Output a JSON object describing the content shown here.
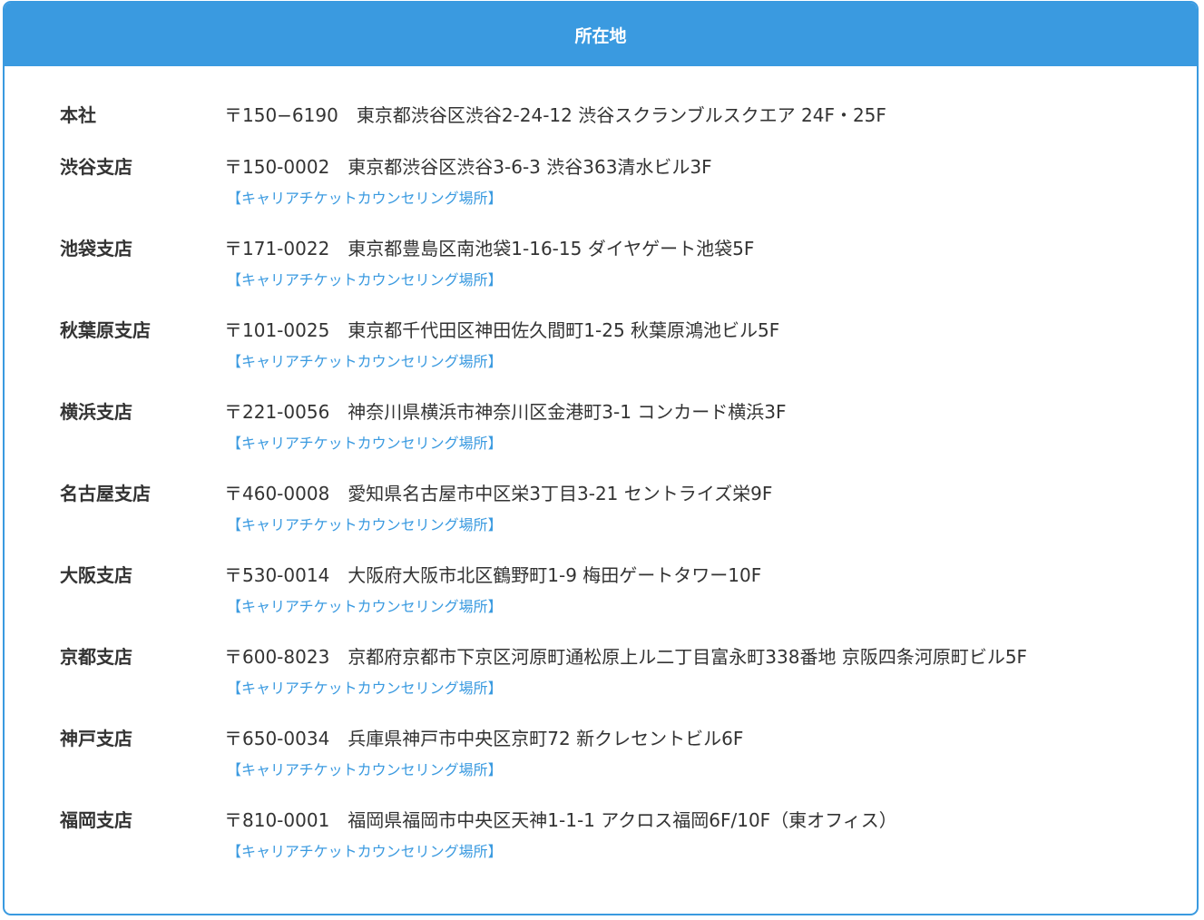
{
  "header": {
    "title": "所在地"
  },
  "offices": [
    {
      "name": "本社",
      "address": "〒150−6190　東京都渋谷区渋谷2-24-12 渋谷スクランブルスクエア 24F・25F",
      "link": ""
    },
    {
      "name": "渋谷支店",
      "address": "〒150-0002　東京都渋谷区渋谷3-6-3 渋谷363清水ビル3F",
      "link": "【キャリアチケットカウンセリング場所】"
    },
    {
      "name": "池袋支店",
      "address": "〒171-0022　東京都豊島区南池袋1-16-15 ダイヤゲート池袋5F",
      "link": "【キャリアチケットカウンセリング場所】"
    },
    {
      "name": "秋葉原支店",
      "address": "〒101-0025　東京都千代田区神田佐久間町1-25 秋葉原鴻池ビル5F",
      "link": "【キャリアチケットカウンセリング場所】"
    },
    {
      "name": "横浜支店",
      "address": "〒221-0056　神奈川県横浜市神奈川区金港町3-1 コンカード横浜3F",
      "link": "【キャリアチケットカウンセリング場所】"
    },
    {
      "name": "名古屋支店",
      "address": "〒460-0008　愛知県名古屋市中区栄3丁目3-21 セントライズ栄9F",
      "link": "【キャリアチケットカウンセリング場所】"
    },
    {
      "name": "大阪支店",
      "address": "〒530-0014　大阪府大阪市北区鶴野町1-9 梅田ゲートタワー10F",
      "link": "【キャリアチケットカウンセリング場所】"
    },
    {
      "name": "京都支店",
      "address": "〒600-8023　京都府京都市下京区河原町通松原上ル二丁目富永町338番地 京阪四条河原町ビル5F",
      "link": "【キャリアチケットカウンセリング場所】"
    },
    {
      "name": "神戸支店",
      "address": "〒650-0034　兵庫県神戸市中央区京町72 新クレセントビル6F",
      "link": "【キャリアチケットカウンセリング場所】"
    },
    {
      "name": "福岡支店",
      "address": "〒810-0001　福岡県福岡市中央区天神1-1-1 アクロス福岡6F/10F（東オフィス）",
      "link": "【キャリアチケットカウンセリング場所】"
    }
  ],
  "colors": {
    "accent": "#3a9ae0",
    "text": "#333333",
    "background": "#ffffff"
  }
}
